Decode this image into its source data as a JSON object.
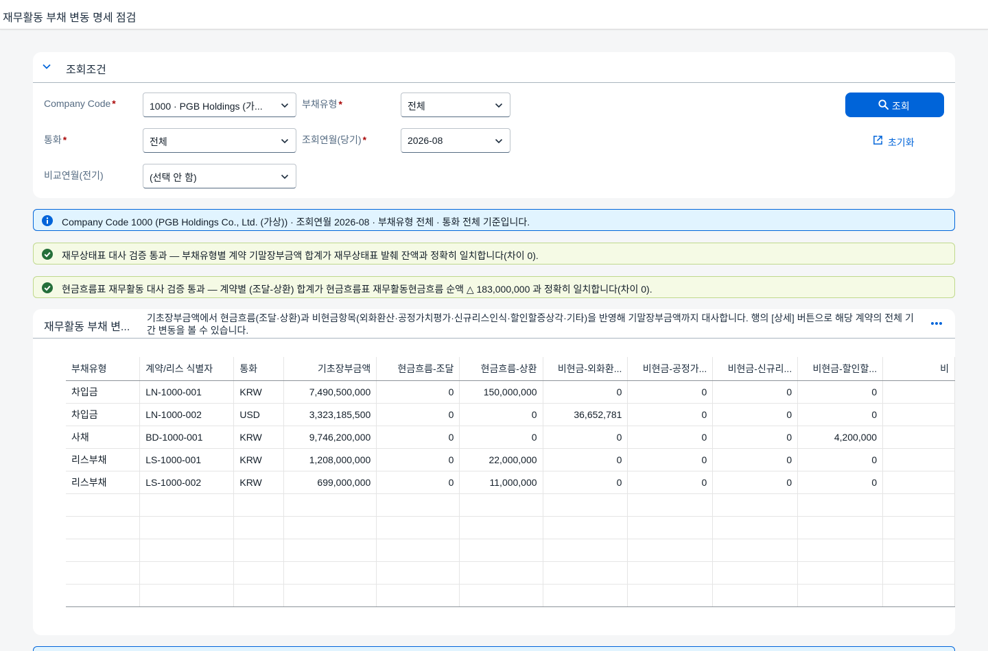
{
  "shell": {
    "title": "재무활동 부채 변동 명세 점검"
  },
  "filter": {
    "title": "조회조건",
    "company_code_label": "Company Code",
    "company_code_value": "1000 · PGB Holdings (가...",
    "liability_type_label": "부채유형",
    "liability_type_value": "전체",
    "currency_label": "통화",
    "currency_value": "전체",
    "period_label": "조회연월(당기)",
    "period_value": "2026-08",
    "compare_label": "비교연월(전기)",
    "compare_value": "(선택 안 함)",
    "required_mark": "*",
    "search_button": "조회",
    "reset_button": "초기화"
  },
  "messages": {
    "info": "Company Code 1000 (PGB Holdings Co., Ltd. (가상)) · 조회연월 2026-08 · 부채유형 전체 · 통화 전체 기준입니다.",
    "success_bs": "재무상태표 대사 검증 통과 — 부채유형별 계약 기말장부금액 합계가 재무상태표 발췌 잔액과 정확히 일치합니다(차이 0).",
    "success_cf": "현금흐름표 재무활동 대사 검증 통과 — 계약별 (조달-상환) 합계가 현금흐름표 재무활동현금흐름 순액 △ 183,000,000 과 정확히 일치합니다(차이 0)."
  },
  "table": {
    "title": "재무활동 부채 변...",
    "description": "기초장부금액에서 현금흐름(조달·상환)과 비현금항목(외화환산·공정가치평가·신규리스인식·할인할증상각·기타)을 반영해 기말장부금액까지 대사합니다. 행의 [상세] 버튼으로 해당 계약의 전체 기간 변동을 볼 수 있습니다.",
    "columns": [
      "부채유형",
      "계약/리스 식별자",
      "통화",
      "기초장부금액",
      "현금흐름-조달",
      "현금흐름-상환",
      "비현금-외화환...",
      "비현금-공정가...",
      "비현금-신규리...",
      "비현금-할인할...",
      "비"
    ],
    "rows": [
      [
        "차입금",
        "LN-1000-001",
        "KRW",
        "7,490,500,000",
        "0",
        "150,000,000",
        "0",
        "0",
        "0",
        "0",
        ""
      ],
      [
        "차입금",
        "LN-1000-002",
        "USD",
        "3,323,185,500",
        "0",
        "0",
        "36,652,781",
        "0",
        "0",
        "0",
        ""
      ],
      [
        "사채",
        "BD-1000-001",
        "KRW",
        "9,746,200,000",
        "0",
        "0",
        "0",
        "0",
        "0",
        "4,200,000",
        ""
      ],
      [
        "리스부채",
        "LS-1000-001",
        "KRW",
        "1,208,000,000",
        "0",
        "22,000,000",
        "0",
        "0",
        "0",
        "0",
        ""
      ],
      [
        "리스부채",
        "LS-1000-002",
        "KRW",
        "699,000,000",
        "0",
        "11,000,000",
        "0",
        "0",
        "0",
        "0",
        ""
      ]
    ],
    "empty_rows": 5
  },
  "colors": {
    "brand": "#0064d9",
    "required": "#aa0808",
    "success": "#256f3a",
    "info": "#0064d9"
  },
  "icons": [
    "chevron-down-icon",
    "search-icon",
    "reset-icon",
    "info-icon",
    "success-icon",
    "more-icon"
  ]
}
